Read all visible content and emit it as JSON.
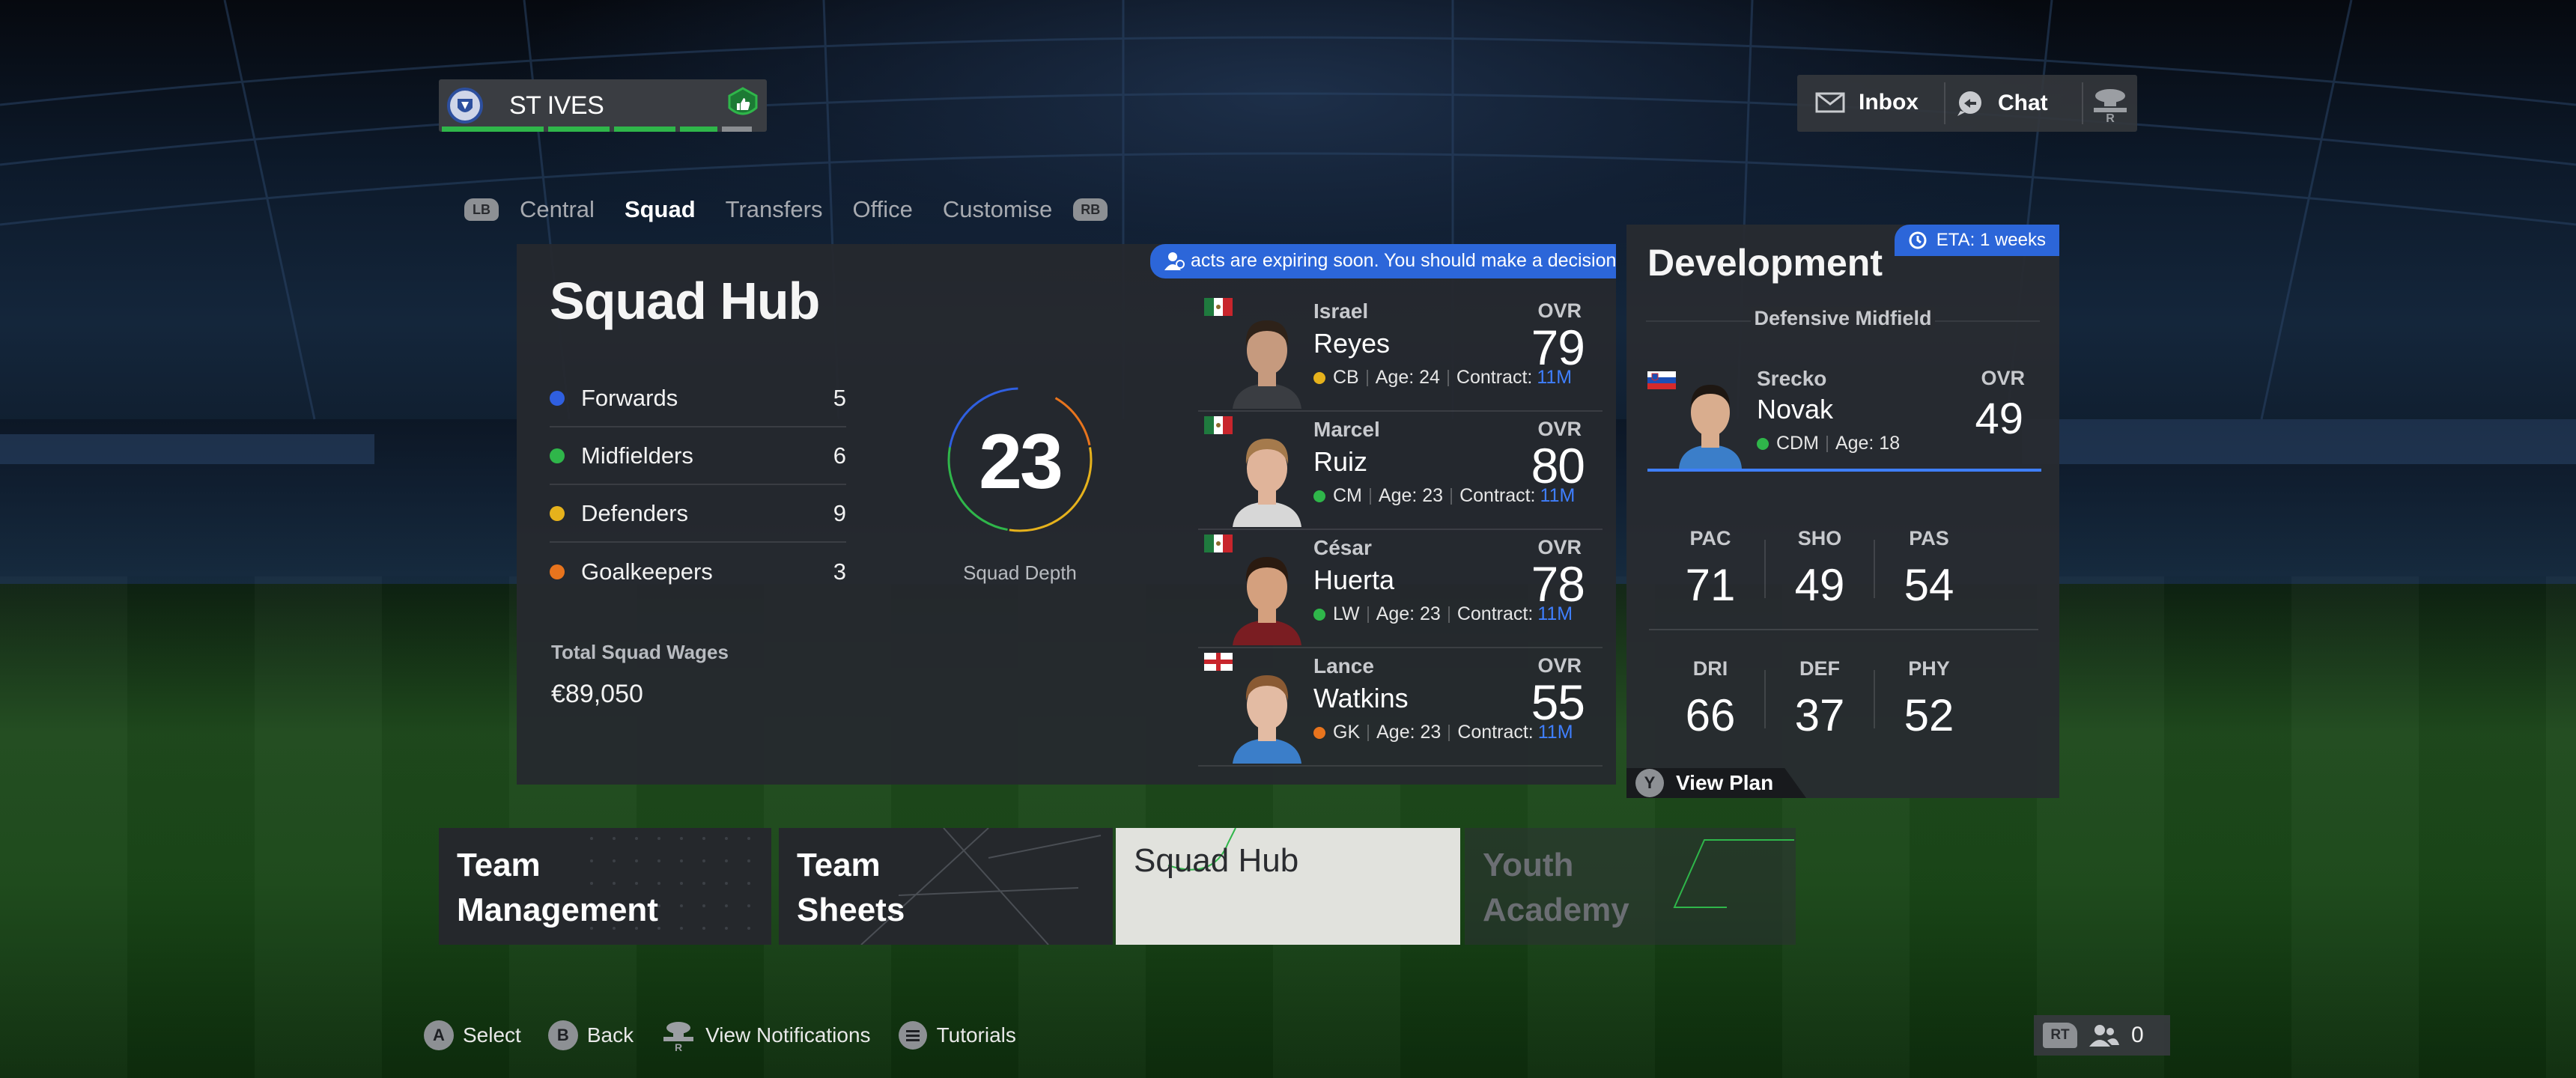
{
  "club": {
    "name": "ST IVES",
    "crest_icon": "club-crest-icon",
    "status_icon": "thumbs-up-shield-icon"
  },
  "header": {
    "inbox_label": "Inbox",
    "chat_label": "Chat",
    "menu_icon": "r-stick-icon"
  },
  "tabs": {
    "left_bumper": "LB",
    "right_bumper": "RB",
    "items": [
      {
        "label": "Central",
        "active": false
      },
      {
        "label": "Squad",
        "active": true
      },
      {
        "label": "Transfers",
        "active": false
      },
      {
        "label": "Office",
        "active": false
      },
      {
        "label": "Customise",
        "active": false
      }
    ]
  },
  "squad_hub": {
    "title": "Squad Hub",
    "positions": [
      {
        "label": "Forwards",
        "count": "5",
        "color": "#2f5fe0"
      },
      {
        "label": "Midfielders",
        "count": "6",
        "color": "#2fb64a"
      },
      {
        "label": "Defenders",
        "count": "9",
        "color": "#e6b21c"
      },
      {
        "label": "Goalkeepers",
        "count": "3",
        "color": "#e8741d"
      }
    ],
    "depth_value": "23",
    "depth_label": "Squad Depth",
    "wages_label": "Total Squad Wages",
    "wages_value": "€89,050",
    "notice": "acts are expiring soon. You should make a decision on th",
    "players": [
      {
        "first": "Israel",
        "last": "Reyes",
        "flag": "mexico",
        "position": "CB",
        "pos_color": "#e6b21c",
        "age": "Age: 24",
        "contract_label": "Contract:",
        "contract": "11M",
        "ovr_label": "OVR",
        "ovr": "79",
        "skin": "#c69a7e",
        "hair": "#2e2219",
        "shirt": "#3a3d42"
      },
      {
        "first": "Marcel",
        "last": "Ruiz",
        "flag": "mexico",
        "position": "CM",
        "pos_color": "#2fb64a",
        "age": "Age: 23",
        "contract_label": "Contract:",
        "contract": "11M",
        "ovr_label": "OVR",
        "ovr": "80",
        "skin": "#e0b49a",
        "hair": "#a57a4c",
        "shirt": "#d7d7d7"
      },
      {
        "first": "César",
        "last": "Huerta",
        "flag": "mexico",
        "position": "LW",
        "pos_color": "#2fb64a",
        "age": "Age: 23",
        "contract_label": "Contract:",
        "contract": "11M",
        "ovr_label": "OVR",
        "ovr": "78",
        "skin": "#d4a07e",
        "hair": "#2a1a10",
        "shirt": "#7a1d22"
      },
      {
        "first": "Lance",
        "last": "Watkins",
        "flag": "england",
        "position": "GK",
        "pos_color": "#e8741d",
        "age": "Age: 23",
        "contract_label": "Contract:",
        "contract": "11M",
        "ovr_label": "OVR",
        "ovr": "55",
        "skin": "#e3bba3",
        "hair": "#8a5a33",
        "shirt": "#3b7ec9"
      }
    ]
  },
  "development": {
    "title": "Development",
    "eta": "ETA: 1 weeks",
    "role": "Defensive Midfield",
    "player": {
      "first": "Srecko",
      "last": "Novak",
      "flag": "slovenia",
      "position": "CDM",
      "age": "Age: 18",
      "ovr_label": "OVR",
      "ovr": "49"
    },
    "stats_row1": [
      {
        "label": "PAC",
        "value": "71"
      },
      {
        "label": "SHO",
        "value": "49"
      },
      {
        "label": "PAS",
        "value": "54"
      }
    ],
    "stats_row2": [
      {
        "label": "DRI",
        "value": "66"
      },
      {
        "label": "DEF",
        "value": "37"
      },
      {
        "label": "PHY",
        "value": "52"
      }
    ],
    "view_plan_button": "Y",
    "view_plan_label": "View Plan"
  },
  "bottom_tiles": [
    {
      "label": "Team Management",
      "line1": "Team",
      "line2": "Management",
      "selected": false
    },
    {
      "label": "Team Sheets",
      "line1": "Team",
      "line2": "Sheets",
      "selected": false
    },
    {
      "label": "Squad Hub",
      "line1": "Squad Hub",
      "line2": "",
      "selected": true
    },
    {
      "label": "Youth Academy",
      "line1": "Youth",
      "line2": "Academy",
      "selected": false
    }
  ],
  "footer": {
    "select_btn": "A",
    "select": "Select",
    "back_btn": "B",
    "back": "Back",
    "notifications": "View Notifications",
    "tutorials": "Tutorials",
    "rt": "RT",
    "friends_count": "0"
  }
}
